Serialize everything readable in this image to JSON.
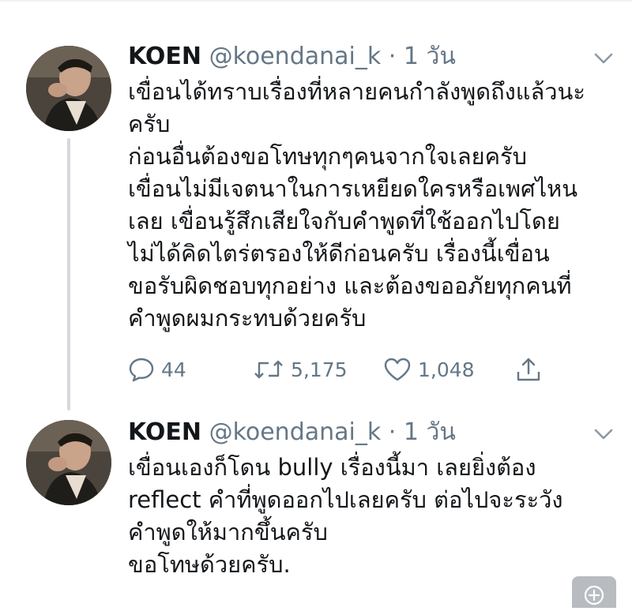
{
  "tweets": [
    {
      "author": {
        "name": "KOEN",
        "handle": "@koendanai_k"
      },
      "separator": "·",
      "time": "1 วัน",
      "lines": [
        "เขื่อนได้ทราบเรื่องที่หลายคนกำลังพูดถึงแล้วนะ",
        "ครับ",
        "ก่อนอื่นต้องขอโทษทุกๆคนจากใจเลยครับ",
        "เขื่อนไม่มีเจตนาในการเหยียดใครหรือเพศไหน",
        "เลย เขื่อนรู้สึกเสียใจกับคำพูดที่ใช้ออกไปโดย",
        "ไม่ได้คิดไตร่ตรองให้ดีก่อนครับ เรื่องนี้เขื่อน",
        "ขอรับผิดชอบทุกอย่าง และต้องขออภัยทุกคนที่",
        "คำพูดผมกระทบด้วยครับ"
      ],
      "stats": {
        "replies": "44",
        "retweets": "5,175",
        "likes": "1,048"
      }
    },
    {
      "author": {
        "name": "KOEN",
        "handle": "@koendanai_k"
      },
      "separator": "·",
      "time": "1 วัน",
      "lines": [
        "เขื่อนเองก็โดน bully เรื่องนี้มา เลยยิ่งต้อง",
        "reflect คำที่พูดออกไปเลยครับ ต่อไปจะระวัง",
        "คำพูดให้มากขึ้นครับ",
        "ขอโทษด้วยครับ."
      ]
    }
  ],
  "icons": {
    "reply": "reply-icon",
    "retweet": "retweet-icon",
    "like": "like-icon",
    "share": "share-icon",
    "caret": "chevron-down-icon",
    "compose": "add-icon"
  },
  "colors": {
    "text": "#14171a",
    "muted": "#657786",
    "thread_line": "#d6d9dd"
  }
}
